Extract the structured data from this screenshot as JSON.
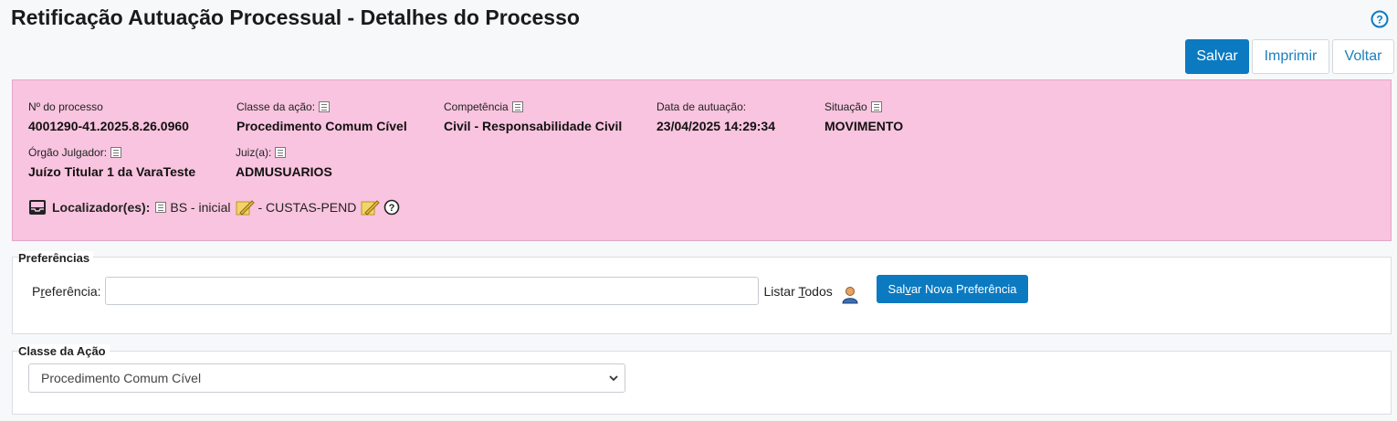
{
  "header": {
    "title": "Retificação Autuação Processual - Detalhes do Processo",
    "buttons": {
      "save": "Salvar",
      "print": "Imprimir",
      "back": "Voltar"
    }
  },
  "process": {
    "numero": {
      "label": "Nº do processo",
      "value": "4001290-41.2025.8.26.0960"
    },
    "classe": {
      "label": "Classe da ação:",
      "value": "Procedimento Comum Cível"
    },
    "competencia": {
      "label": "Competência",
      "value": "Civil - Responsabilidade Civil"
    },
    "data": {
      "label": "Data de autuação:",
      "value": "23/04/2025 14:29:34"
    },
    "situacao": {
      "label": "Situação",
      "value": "MOVIMENTO"
    },
    "orgao": {
      "label": "Órgão Julgador:",
      "value": "Juízo Titular 1 da VaraTeste"
    },
    "juiz": {
      "label": "Juiz(a):",
      "value": "ADMUSUARIOS"
    },
    "localizadores": {
      "label": "Localizador(es):",
      "items": [
        "BS - inicial",
        "- CUSTAS-PEND"
      ]
    }
  },
  "preferencias": {
    "legend": "Preferências",
    "label_pre": "P",
    "label_ul": "r",
    "label_post": "eferência:",
    "input_value": "",
    "listar_pre": "Listar ",
    "listar_ul": "T",
    "listar_post": "odos",
    "save_pre": "Sal",
    "save_ul": "v",
    "save_post": "ar Nova Preferência"
  },
  "classe_acao": {
    "legend": "Classe da Ação",
    "selected": "Procedimento Comum Cível"
  },
  "colors": {
    "accent": "#0b7ac1",
    "panel_bg": "#f9c4df"
  }
}
